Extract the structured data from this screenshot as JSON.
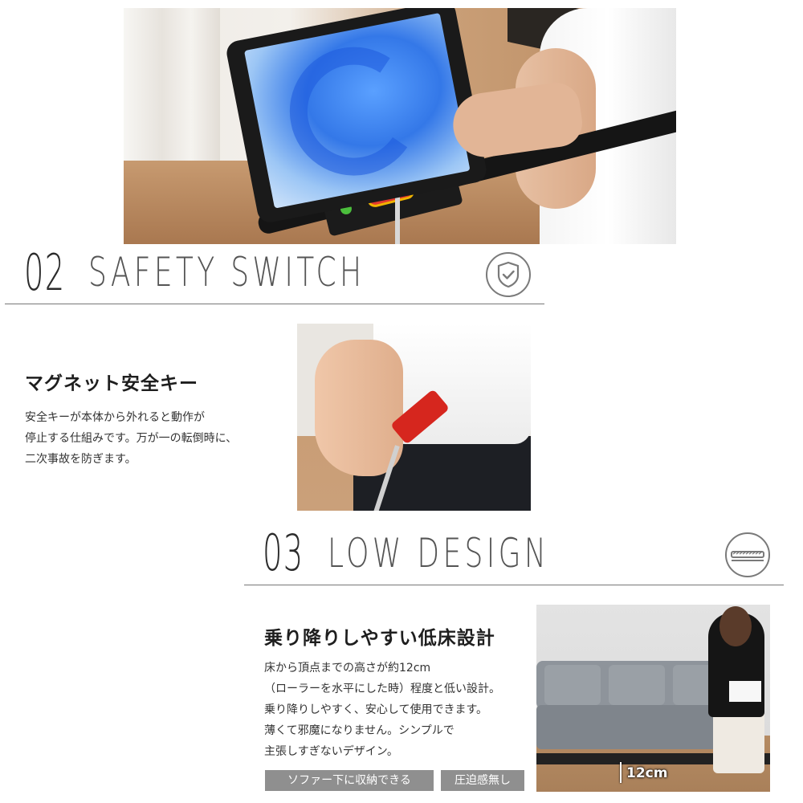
{
  "colors": {
    "accent_red": "#e23a2e",
    "line_gray": "#777777",
    "tag_bg": "#8f8f8f"
  },
  "sections": [
    {
      "number": "02",
      "title": "SAFETY SWITCH",
      "icon": "shield-check-icon",
      "heading": "マグネット安全キー",
      "body": [
        "安全キーが本体から外れると動作が",
        "停止する仕組みです。万が一の転倒時に、",
        "二次事故を防ぎます。"
      ]
    },
    {
      "number": "03",
      "title": "LOW DESIGN",
      "icon": "low-profile-treadmill-icon",
      "heading": "乗り降りしやすい低床設計",
      "body": [
        "床から頂点までの高さが約12cm",
        "（ローラーを水平にした時）程度と低い設計。",
        "乗り降りしやすく、安心して使用できます。",
        "薄くて邪魔になりません。シンプルで",
        "主張しすぎないデザイン。"
      ],
      "photo_label": "12cm",
      "tags": [
        "ソファー下に収納できる",
        "圧迫感無し"
      ]
    }
  ]
}
